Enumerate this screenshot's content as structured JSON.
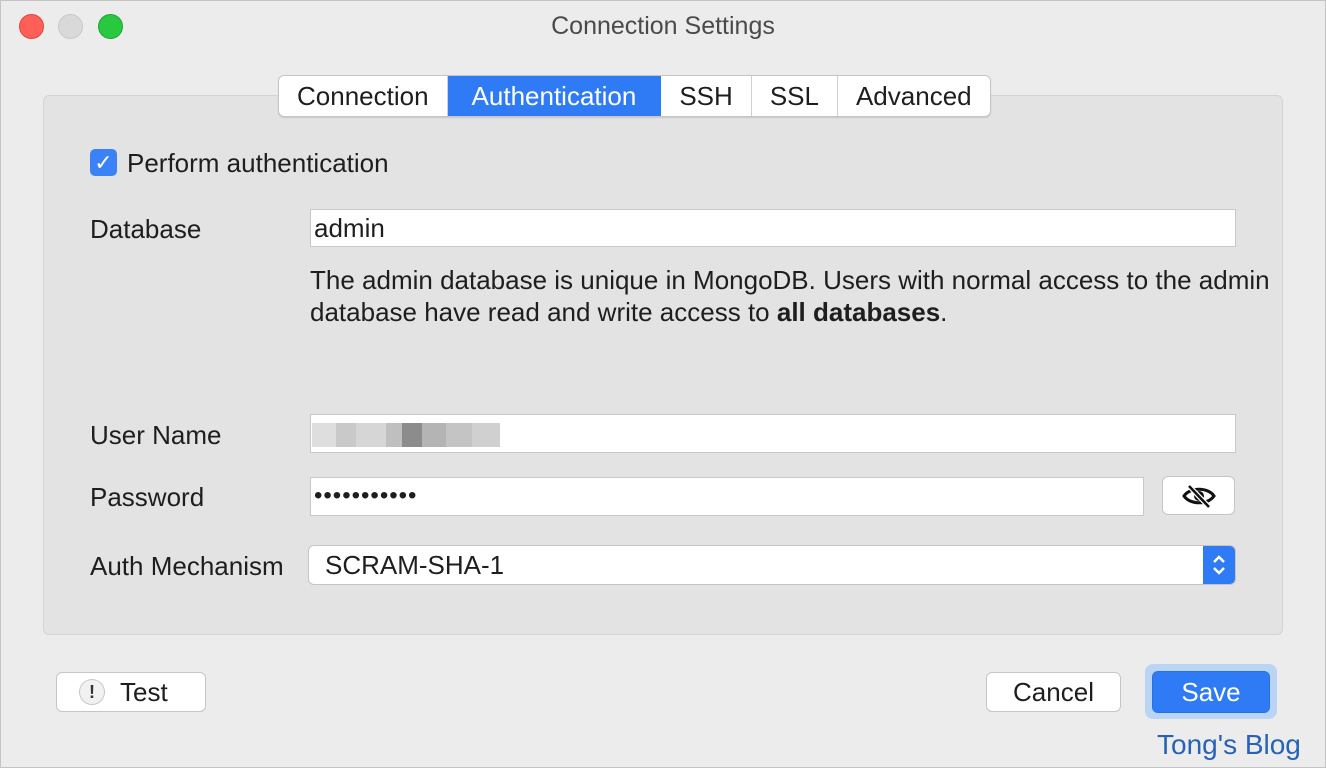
{
  "window": {
    "title": "Connection Settings"
  },
  "tabs": [
    {
      "label": "Connection",
      "active": false
    },
    {
      "label": "Authentication",
      "active": true
    },
    {
      "label": "SSH",
      "active": false
    },
    {
      "label": "SSL",
      "active": false
    },
    {
      "label": "Advanced",
      "active": false
    }
  ],
  "auth": {
    "perform_label": "Perform authentication",
    "perform_checked": true,
    "database_label": "Database",
    "database_value": "admin",
    "hint_text": "The admin database is unique in MongoDB. Users with normal access to the admin database have read and write access to ",
    "hint_bold": "all databases",
    "hint_end": ".",
    "username_label": "User Name",
    "password_label": "Password",
    "password_value": "•••••••••••",
    "mechanism_label": "Auth Mechanism",
    "mechanism_value": "SCRAM-SHA-1"
  },
  "footer": {
    "test_label": "Test",
    "cancel_label": "Cancel",
    "save_label": "Save"
  },
  "watermark": "Tong's Blog",
  "colors": {
    "accent": "#2f7bf5",
    "checkbox": "#3a82f6",
    "close": "#fe5f57",
    "maximize": "#28c840"
  }
}
